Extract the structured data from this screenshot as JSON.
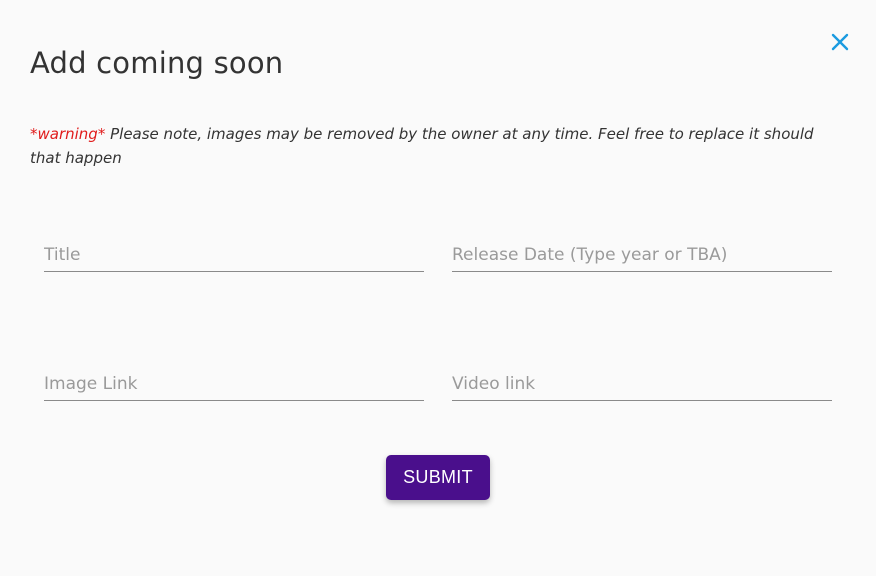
{
  "dialog": {
    "title": "Add coming soon",
    "close_icon": "close-icon",
    "accent_color": "#1a9be0"
  },
  "warning": {
    "tag": "*warning*",
    "text": " Please note, images may be removed by the owner at any time. Feel free to replace it should that happen",
    "tag_color": "#e01b1b"
  },
  "form": {
    "title_placeholder": "Title",
    "release_placeholder": "Release Date (Type year or TBA)",
    "image_placeholder": "Image Link",
    "video_placeholder": "Video link"
  },
  "submit": {
    "label": "SUBMIT",
    "color": "#4a0f8c"
  }
}
